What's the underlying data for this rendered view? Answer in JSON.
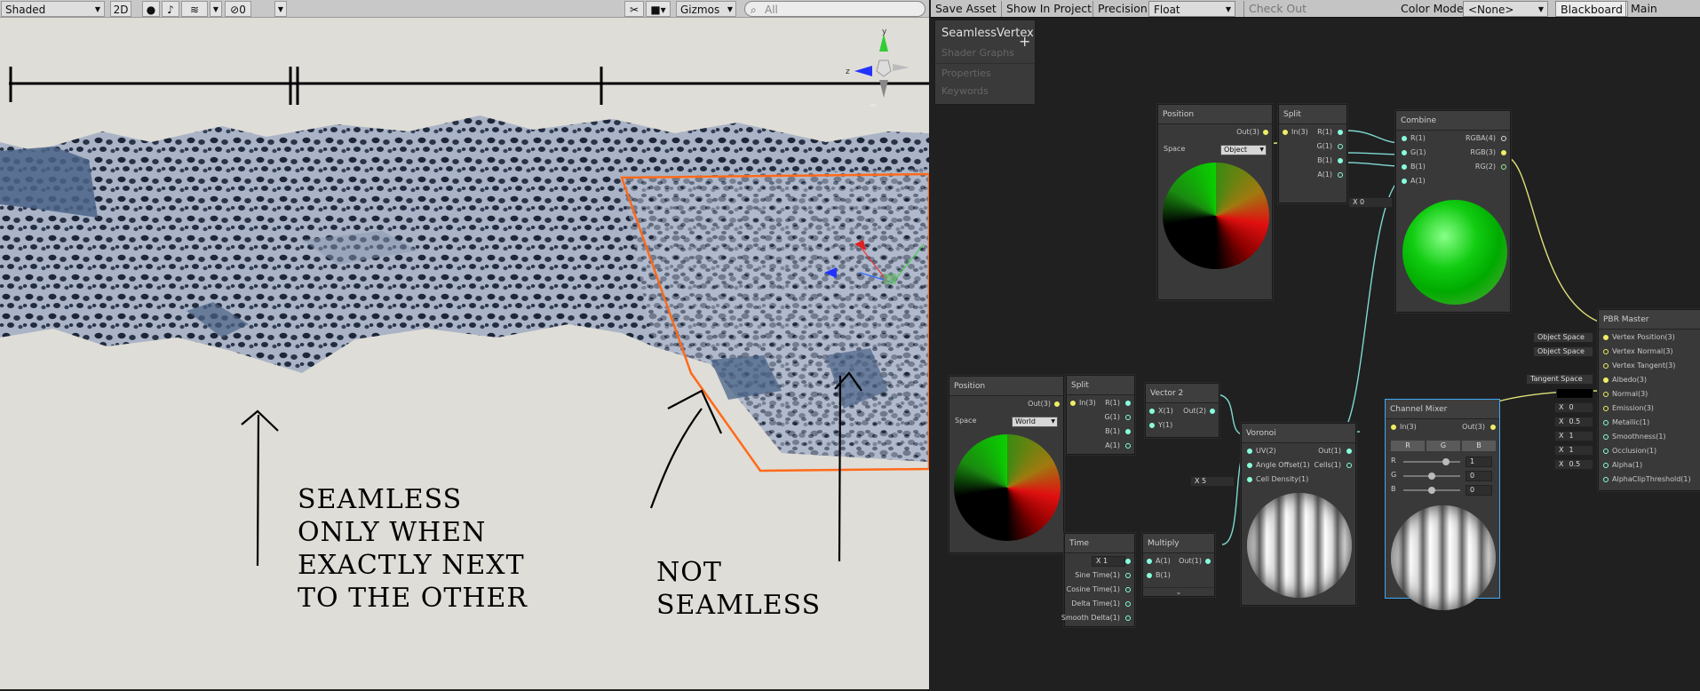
{
  "scene_toolbar": {
    "shading_mode": "Shaded",
    "mode_2d": "2D",
    "hidden_count": "0",
    "gizmos_label": "Gizmos",
    "search_placeholder": "All"
  },
  "annotations": {
    "seamless_text": [
      "SEAMLESS",
      "ONLY WHEN",
      "EXACTLY NEXT",
      "TO THE OTHER"
    ],
    "not_seamless_text": [
      "NOT",
      "SEAMLESS"
    ]
  },
  "graph_toolbar": {
    "save_asset": "Save Asset",
    "show_in_project": "Show In Project",
    "precision_label": "Precision",
    "precision_value": "Float",
    "check_out": "Check Out",
    "color_mode_label": "Color Mode",
    "color_mode_value": "<None>",
    "blackboard": "Blackboard",
    "main_preview": "Main Preview"
  },
  "blackboard": {
    "title": "SeamlessVertexDis",
    "subtitle": "Shader Graphs",
    "properties": "Properties",
    "keywords": "Keywords"
  },
  "nodes": {
    "position_object": {
      "title": "Position",
      "out": "Out(3)",
      "space_label": "Space",
      "space_value": "Object"
    },
    "split_top": {
      "title": "Split",
      "in": "In(3)",
      "outs": [
        "R(1)",
        "G(1)",
        "B(1)",
        "A(1)"
      ]
    },
    "combine": {
      "title": "Combine",
      "ins": [
        "R(1)",
        "G(1)",
        "B(1)",
        "A(1)"
      ],
      "outs": [
        "RGBA(4)",
        "RGB(3)",
        "RG(2)"
      ],
      "a_default_x": "X",
      "a_default_v": "0"
    },
    "position_world": {
      "title": "Position",
      "out": "Out(3)",
      "space_label": "Space",
      "space_value": "World"
    },
    "split_bottom": {
      "title": "Split",
      "in": "In(3)",
      "outs": [
        "R(1)",
        "G(1)",
        "B(1)",
        "A(1)"
      ]
    },
    "vector2": {
      "title": "Vector 2",
      "ins": [
        "X(1)",
        "Y(1)"
      ],
      "out": "Out(2)"
    },
    "voronoi": {
      "title": "Voronoi",
      "ins": [
        "UV(2)",
        "Angle Offset(1)",
        "Cell Density(1)"
      ],
      "outs": [
        "Out(1)",
        "Cells(1)"
      ],
      "density_x": "X",
      "density_v": "5"
    },
    "time": {
      "title": "Time",
      "outs": [
        "Time(1)",
        "Sine Time(1)",
        "Cosine Time(1)",
        "Delta Time(1)",
        "Smooth Delta(1)"
      ],
      "x": "X",
      "v": "1"
    },
    "multiply": {
      "title": "Multiply",
      "ins": [
        "A(1)",
        "B(1)"
      ],
      "out": "Out(1)"
    },
    "channel_mixer": {
      "title": "Channel Mixer",
      "in": "In(3)",
      "out": "Out(3)",
      "tabs": [
        "R",
        "G",
        "B"
      ],
      "rows": [
        {
          "label": "R",
          "value": "1",
          "frac": 0.75
        },
        {
          "label": "G",
          "value": "0",
          "frac": 0.5
        },
        {
          "label": "B",
          "value": "0",
          "frac": 0.5
        }
      ]
    },
    "pbr_master": {
      "title": "PBR Master",
      "ins": [
        "Vertex Position(3)",
        "Vertex Normal(3)",
        "Vertex Tangent(3)",
        "Albedo(3)",
        "Normal(3)",
        "Emission(3)",
        "Metallic(1)",
        "Smoothness(1)",
        "Occlusion(1)",
        "Alpha(1)",
        "AlphaClipThreshold(1)"
      ],
      "space_defaults": [
        "Object Space",
        "Object Space",
        "Tangent Space"
      ],
      "x": "X",
      "scalar_defaults": [
        "0",
        "0.5",
        "1",
        "1",
        "0.5"
      ]
    }
  },
  "colors": {
    "selection_orange": "#ff6a1a",
    "wire_cyan": "#7fd8d0",
    "wire_yellow": "#e0e07a",
    "channel_mixer_border": "#3fa9f5"
  }
}
